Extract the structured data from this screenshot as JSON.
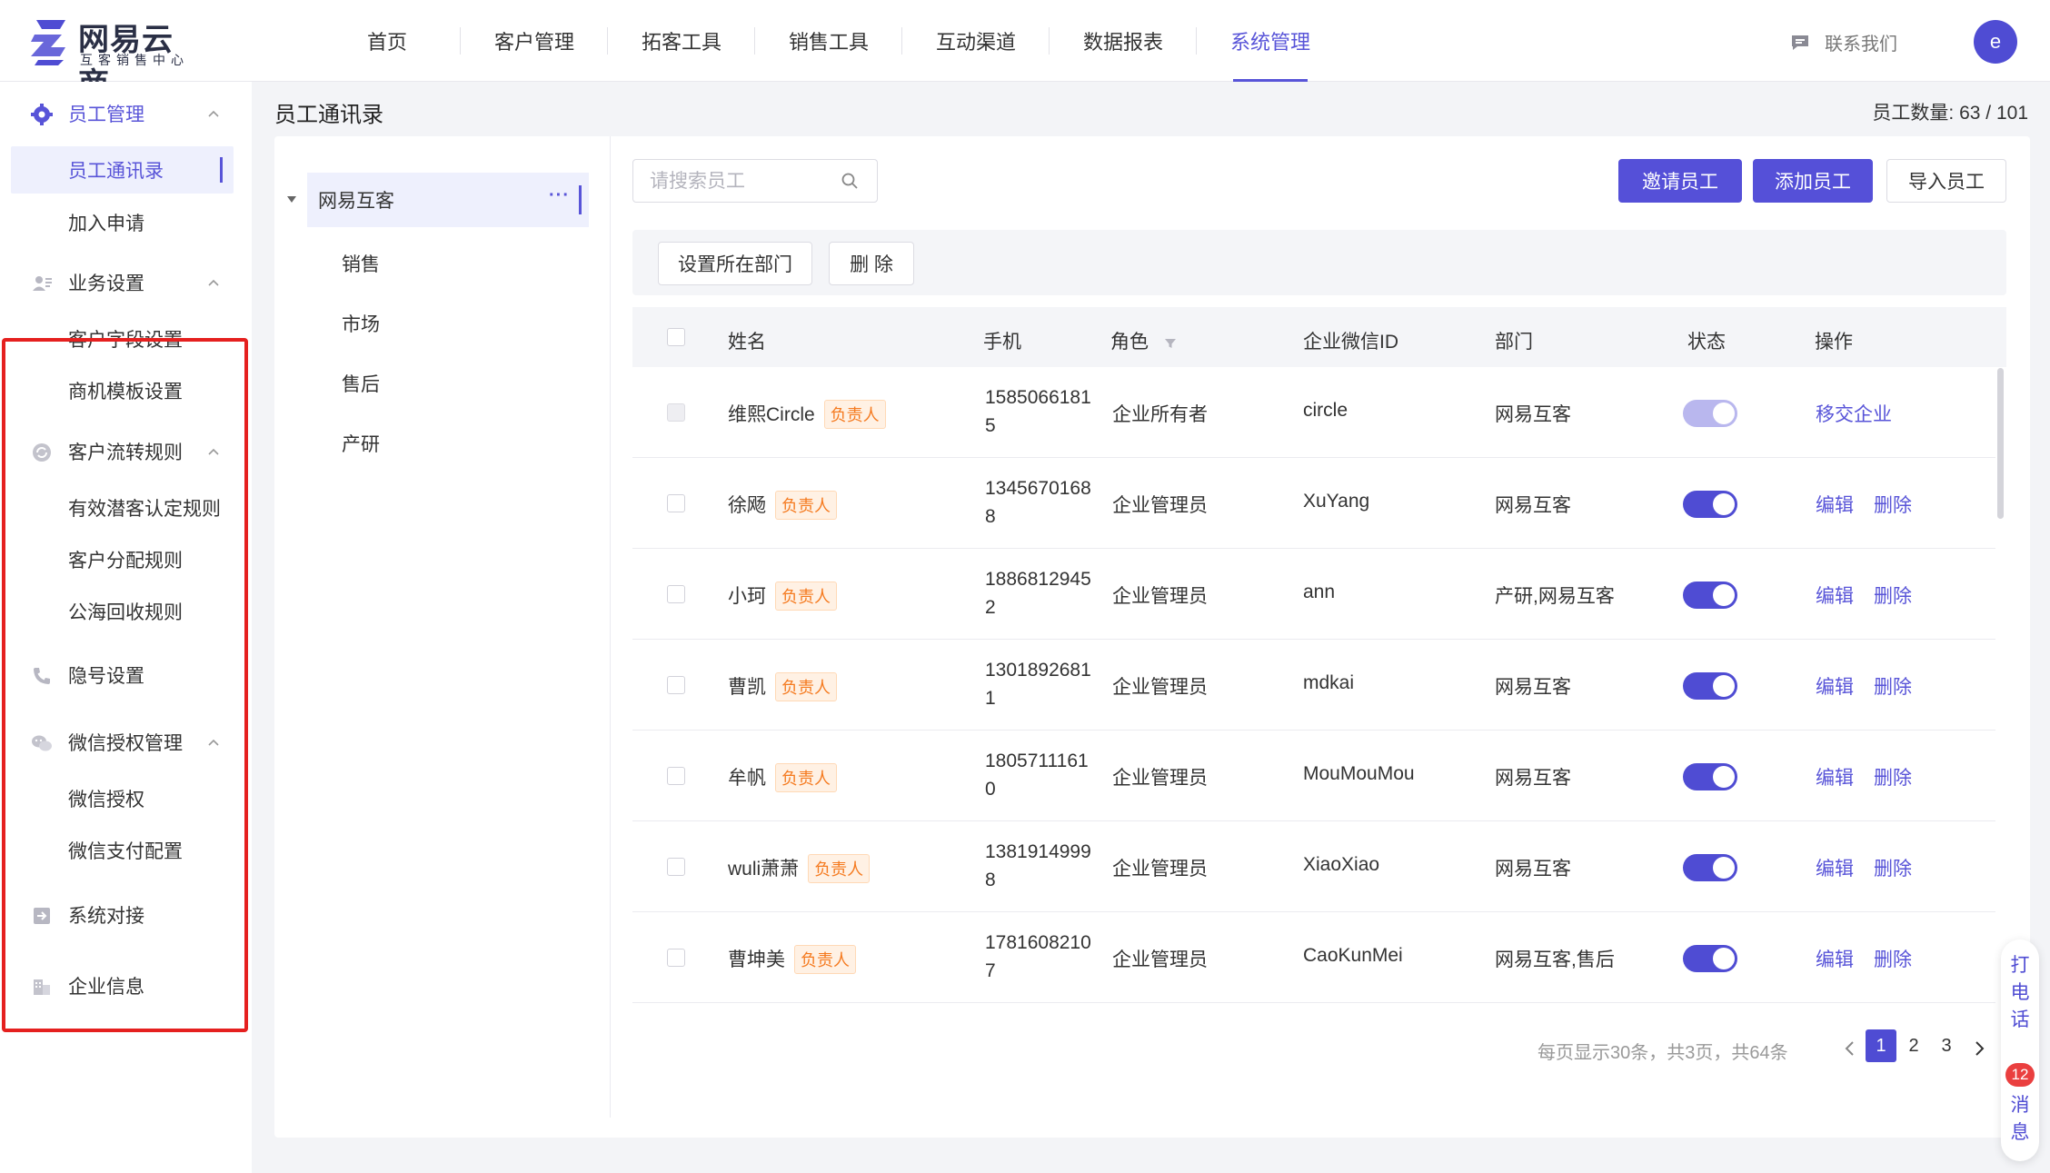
{
  "brand": {
    "name": "网易云商",
    "subtitle": "互客销售中心"
  },
  "nav": {
    "items": [
      "首页",
      "客户管理",
      "拓客工具",
      "销售工具",
      "互动渠道",
      "数据报表",
      "系统管理"
    ],
    "active_index": 6,
    "contact": "联系我们",
    "avatar_letter": "e"
  },
  "sidebar": {
    "groups": {
      "employee": "员工管理",
      "business": "业务设置",
      "flow": "客户流转规则",
      "privacy": "隐号设置",
      "wechat": "微信授权管理",
      "integration": "系统对接",
      "company": "企业信息"
    },
    "items": {
      "directory": "员工通讯录",
      "join": "加入申请",
      "custom_fields": "客户字段设置",
      "opportunity_template": "商机模板设置",
      "valid_lead": "有效潜客认定规则",
      "allocation": "客户分配规则",
      "recycle": "公海回收规则",
      "wechat_auth": "微信授权",
      "wechat_pay": "微信支付配置"
    }
  },
  "page": {
    "title": "员工通讯录",
    "count_label": "员工数量:",
    "count_value": "63 / 101"
  },
  "tree": {
    "root": "网易互客",
    "more": "···",
    "children": [
      "销售",
      "市场",
      "售后",
      "产研"
    ]
  },
  "toolbar": {
    "search_placeholder": "请搜索员工",
    "invite": "邀请员工",
    "add": "添加员工",
    "import": "导入员工",
    "set_dept": "设置所在部门",
    "delete": "删 除"
  },
  "table": {
    "headers": {
      "name": "姓名",
      "phone": "手机",
      "role": "角色",
      "wechat_id": "企业微信ID",
      "dept": "部门",
      "status": "状态",
      "actions": "操作"
    },
    "owner_tag": "负责人",
    "rows": [
      {
        "name": "维熙Circle",
        "phone1": "1585066181",
        "phone2": "5",
        "role": "企业所有者",
        "wechat_id": "circle",
        "dept": "网易互客",
        "enabled": true,
        "locked": true,
        "action1": "移交企业",
        "action2": ""
      },
      {
        "name": "徐飏",
        "phone1": "1345670168",
        "phone2": "8",
        "role": "企业管理员",
        "wechat_id": "XuYang",
        "dept": "网易互客",
        "enabled": true,
        "locked": false,
        "action1": "编辑",
        "action2": "删除"
      },
      {
        "name": "小珂",
        "phone1": "1886812945",
        "phone2": "2",
        "role": "企业管理员",
        "wechat_id": "ann",
        "dept": "产研,网易互客",
        "enabled": true,
        "locked": false,
        "action1": "编辑",
        "action2": "删除"
      },
      {
        "name": "曹凯",
        "phone1": "1301892681",
        "phone2": "1",
        "role": "企业管理员",
        "wechat_id": "mdkai",
        "dept": "网易互客",
        "enabled": true,
        "locked": false,
        "action1": "编辑",
        "action2": "删除"
      },
      {
        "name": "牟帆",
        "phone1": "1805711161",
        "phone2": "0",
        "role": "企业管理员",
        "wechat_id": "MouMouMou",
        "dept": "网易互客",
        "enabled": true,
        "locked": false,
        "action1": "编辑",
        "action2": "删除"
      },
      {
        "name": "wuli萧萧",
        "phone1": "1381914999",
        "phone2": "8",
        "role": "企业管理员",
        "wechat_id": "XiaoXiao",
        "dept": "网易互客",
        "enabled": true,
        "locked": false,
        "action1": "编辑",
        "action2": "删除"
      },
      {
        "name": "曹坤美",
        "phone1": "1781608210",
        "phone2": "7",
        "role": "企业管理员",
        "wechat_id": "CaoKunMei",
        "dept": "网易互客,售后",
        "enabled": true,
        "locked": false,
        "action1": "编辑",
        "action2": "删除"
      }
    ]
  },
  "pagination": {
    "info": "每页显示30条，共3页，共64条",
    "pages": [
      "1",
      "2",
      "3"
    ],
    "current": "1"
  },
  "float": {
    "call": "打电话",
    "badge": "12",
    "message": "消息"
  },
  "colors": {
    "accent": "#5550d8",
    "highlight": "#e5201f",
    "tag": "#f57a1f"
  }
}
